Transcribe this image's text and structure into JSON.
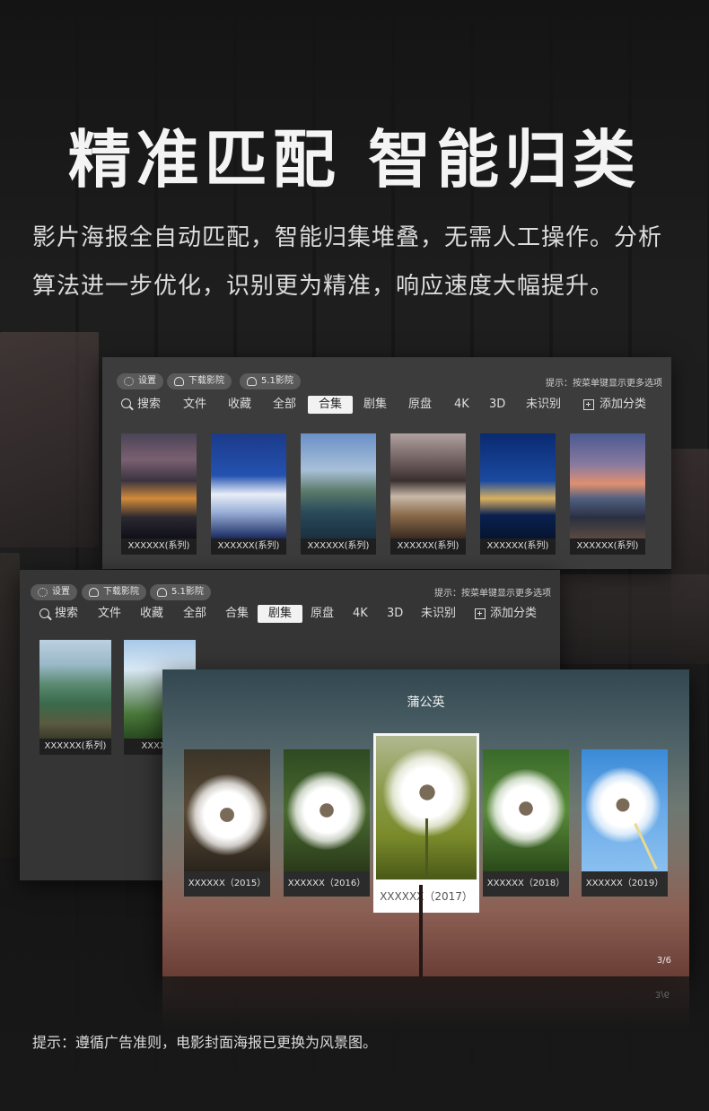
{
  "headline": "精准匹配 智能归类",
  "description": "影片海报全自动匹配，智能归集堆叠，无需人工操作。分析算法进一步优化，识别更为精准，响应速度大幅提升。",
  "panel_top": {
    "pills": [
      "设置",
      "下载影院",
      "5.1影院"
    ],
    "hint": "提示：按菜单键显示更多选项",
    "search_label": "搜索",
    "tabs": [
      "文件",
      "收藏",
      "全部",
      "合集",
      "剧集",
      "原盘",
      "4K",
      "3D",
      "未识别"
    ],
    "active_tab": "合集",
    "add_category": "添加分类",
    "items": [
      "XXXXXX(系列)",
      "XXXXXX(系列)",
      "XXXXXX(系列)",
      "XXXXXX(系列)",
      "XXXXXX(系列)",
      "XXXXXX(系列)"
    ]
  },
  "panel_middle": {
    "pills": [
      "设置",
      "下载影院",
      "5.1影院"
    ],
    "hint": "提示：按菜单键显示更多选项",
    "search_label": "搜索",
    "tabs": [
      "文件",
      "收藏",
      "全部",
      "合集",
      "剧集",
      "原盘",
      "4K",
      "3D",
      "未识别"
    ],
    "active_tab": "剧集",
    "add_category": "添加分类",
    "items": [
      "XXXXXX(系列)",
      "XXXXXX"
    ]
  },
  "detail": {
    "title": "蒲公英",
    "cards": [
      "XXXXXX（2015）",
      "XXXXXX（2016）",
      "XXXXXX（2017）",
      "XXXXXX（2018）",
      "XXXXXX（2019）"
    ],
    "selected_index": 2,
    "pager": "3/6"
  },
  "footnote": "提示：遵循广告准则，电影封面海报已更换为风景图。",
  "colors": {
    "background": "#171717",
    "panel": "#3a3a3a",
    "active_tab_bg": "#f2f2f2",
    "caption_bg": "#1f1f1f"
  }
}
